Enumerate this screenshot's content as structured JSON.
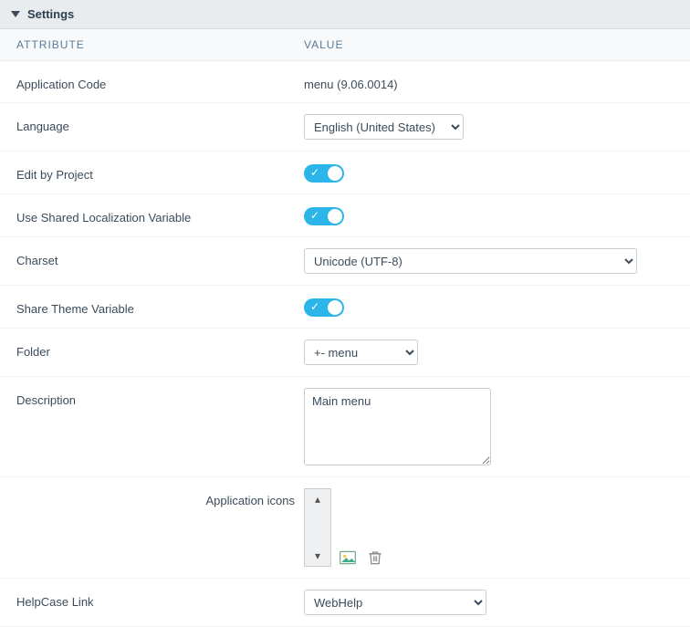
{
  "section_title": "Settings",
  "headers": {
    "attribute": "ATTRIBUTE",
    "value": "VALUE"
  },
  "app_code": {
    "label": "Application Code",
    "value": "menu (9.06.0014)"
  },
  "language": {
    "label": "Language",
    "selected": "English (United States)",
    "options": [
      "English (United States)"
    ]
  },
  "edit_by_project": {
    "label": "Edit by Project",
    "on": true
  },
  "use_shared_loc": {
    "label": "Use Shared Localization Variable",
    "on": true
  },
  "charset": {
    "label": "Charset",
    "selected": "Unicode (UTF-8)",
    "options": [
      "Unicode (UTF-8)"
    ]
  },
  "share_theme": {
    "label": "Share Theme Variable",
    "on": true
  },
  "folder": {
    "label": "Folder",
    "selected": "+- menu",
    "options": [
      "+- menu"
    ]
  },
  "description": {
    "label": "Description",
    "value": "Main menu"
  },
  "app_icons": {
    "label": "Application icons"
  },
  "helpcase": {
    "label": "HelpCase Link",
    "selected": "WebHelp",
    "options": [
      "WebHelp"
    ]
  }
}
